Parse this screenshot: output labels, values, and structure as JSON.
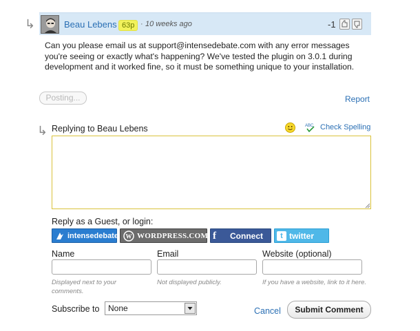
{
  "comment": {
    "author": "Beau Lebens",
    "reputation": "63p",
    "separator": "·",
    "time": "10 weeks ago",
    "votes": "-1",
    "body": "Can you please email us at support@intensedebate.com with any error messages you're seeing or exactly what's happening? We've tested the plugin on 3.0.1 during development and it worked fine, so it must be something unique to your installation.",
    "posting_label": "Posting...",
    "report_label": "Report"
  },
  "reply": {
    "replying_to": "Replying to Beau Lebens",
    "check_spelling": "Check Spelling",
    "textarea_value": ""
  },
  "login": {
    "label": "Reply as a Guest, or login:",
    "intensedebate": "intensedebate",
    "wordpress": "WORDPRESS.COM",
    "facebook": "Connect",
    "twitter": "twitter"
  },
  "fields": {
    "name_label": "Name",
    "name_hint": "Displayed next to your comments.",
    "email_label": "Email",
    "email_hint": "Not displayed publicly.",
    "website_label": "Website (optional)",
    "website_hint": "If you have a website, link to it here."
  },
  "subscribe": {
    "label": "Subscribe to",
    "selected": "None"
  },
  "actions": {
    "cancel": "Cancel",
    "submit": "Submit Comment"
  },
  "icons": {
    "reply_arrow": "reply-arrow-icon",
    "thumbs_up": "thumbs-up-icon",
    "thumbs_down": "thumbs-down-icon",
    "emoticon": "emoticon-icon",
    "spellcheck": "spellcheck-icon"
  },
  "colors": {
    "accent_link": "#2a6fb4",
    "header_bg": "#d7e8f6",
    "reputation_badge": "#f2f25c",
    "textarea_border": "#d9c23a"
  }
}
